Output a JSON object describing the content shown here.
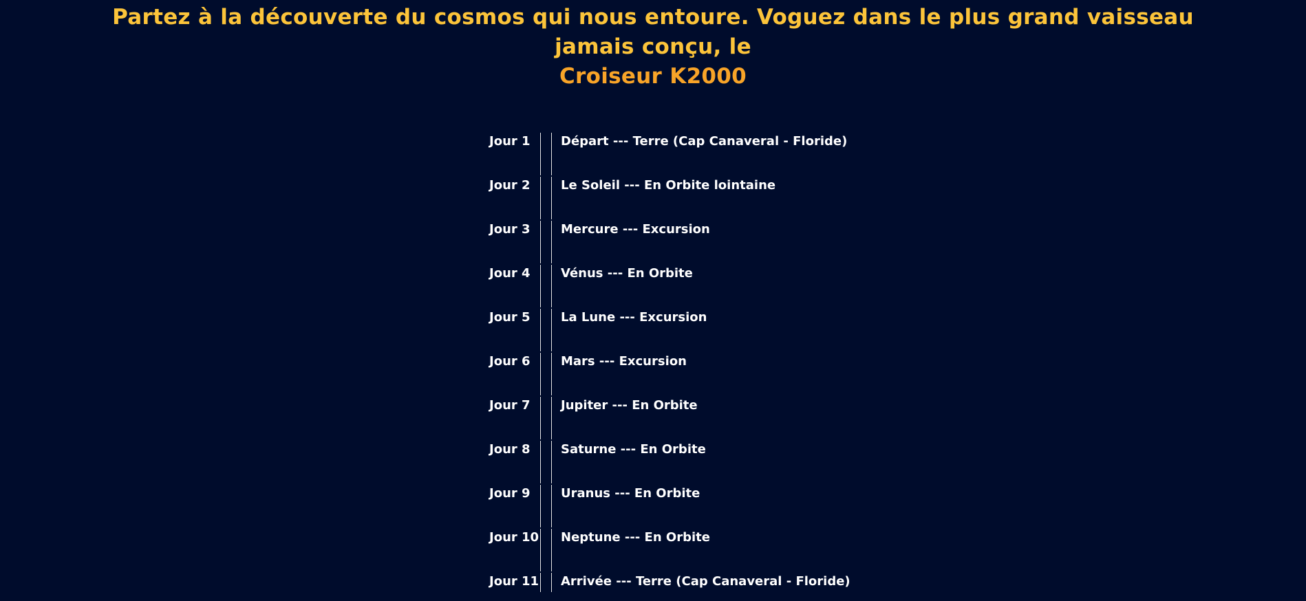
{
  "heading": {
    "lead": "Partez à la découverte du cosmos qui nous entoure. Voguez dans le plus grand vaisseau jamais conçu, le",
    "brand": "Croiseur K2000"
  },
  "colors": {
    "background": "#000c2c",
    "heading": "#fcc43a",
    "brand": "#f8a428",
    "text": "#ffffff"
  },
  "schedule": [
    {
      "day": "Jour 1",
      "event": "Départ --- Terre (Cap Canaveral - Floride)"
    },
    {
      "day": "Jour 2",
      "event": "Le Soleil --- En Orbite lointaine"
    },
    {
      "day": "Jour 3",
      "event": "Mercure --- Excursion"
    },
    {
      "day": "Jour 4",
      "event": "Vénus --- En Orbite"
    },
    {
      "day": "Jour 5",
      "event": "La Lune --- Excursion"
    },
    {
      "day": "Jour 6",
      "event": "Mars --- Excursion"
    },
    {
      "day": "Jour 7",
      "event": "Jupiter --- En Orbite"
    },
    {
      "day": "Jour 8",
      "event": "Saturne --- En Orbite"
    },
    {
      "day": "Jour 9",
      "event": "Uranus --- En Orbite"
    },
    {
      "day": "Jour 10",
      "event": "Neptune --- En Orbite"
    },
    {
      "day": "Jour 11",
      "event": "Arrivée --- Terre (Cap Canaveral - Floride)"
    }
  ]
}
